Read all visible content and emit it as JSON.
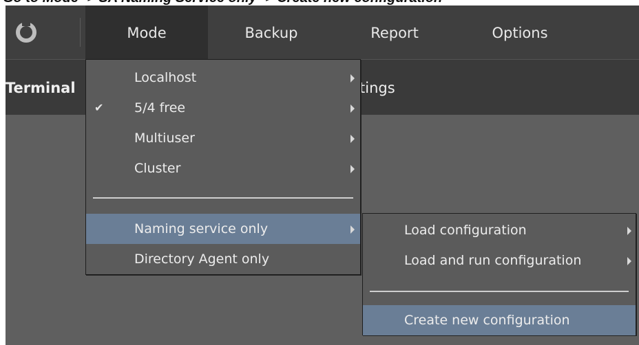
{
  "caption": "Go to Mode -> SA Naming Service only -> Create new configuration",
  "topbar": {
    "tabs": [
      {
        "label": "Mode"
      },
      {
        "label": "Backup"
      },
      {
        "label": "Report"
      },
      {
        "label": "Options"
      }
    ]
  },
  "subbar": {
    "items": [
      {
        "label": "Terminal"
      },
      {
        "label": "tings"
      }
    ]
  },
  "mode_menu": {
    "items": [
      {
        "label": "Localhost",
        "checked": false,
        "submenu": true
      },
      {
        "label": "5/4 free",
        "checked": true,
        "submenu": true
      },
      {
        "label": "Multiuser",
        "checked": false,
        "submenu": true
      },
      {
        "label": "Cluster",
        "checked": false,
        "submenu": true
      },
      {
        "label": "Naming service only",
        "checked": false,
        "submenu": true,
        "highlighted": true
      },
      {
        "label": "Directory Agent only",
        "checked": false,
        "submenu": false
      }
    ],
    "check_glyph": "✔"
  },
  "naming_submenu": {
    "items": [
      {
        "label": "Load configuration",
        "submenu": true
      },
      {
        "label": "Load and run configuration",
        "submenu": true
      },
      {
        "label": "Create new configuration",
        "submenu": false,
        "highlighted": true
      }
    ]
  },
  "colors": {
    "highlight": "#6a7e96",
    "menu_bg": "#5b5b5b",
    "topbar_bg": "#3f3f3f"
  }
}
